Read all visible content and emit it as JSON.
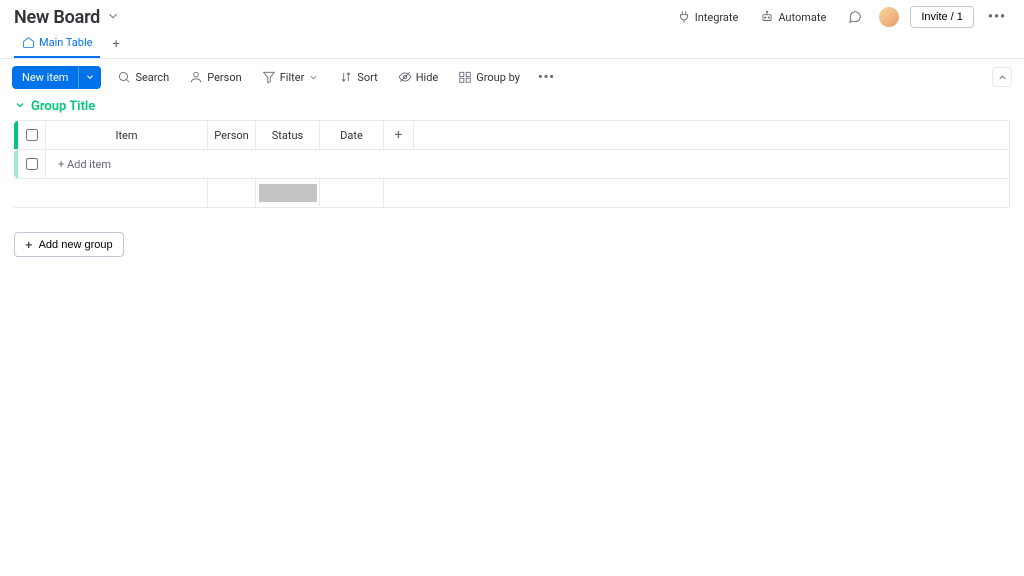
{
  "header": {
    "title": "New Board",
    "actions": {
      "integrate": "Integrate",
      "automate": "Automate"
    },
    "invite_label": "Invite / 1"
  },
  "tabs": {
    "main_table": "Main Table"
  },
  "toolbar": {
    "new_item": "New item",
    "search": "Search",
    "person": "Person",
    "filter": "Filter",
    "sort": "Sort",
    "hide": "Hide",
    "group_by": "Group by"
  },
  "group": {
    "title": "Group Title",
    "columns": {
      "item": "Item",
      "person": "Person",
      "status": "Status",
      "date": "Date"
    },
    "add_item_placeholder": "+ Add item"
  },
  "add_new_group": "Add new group"
}
